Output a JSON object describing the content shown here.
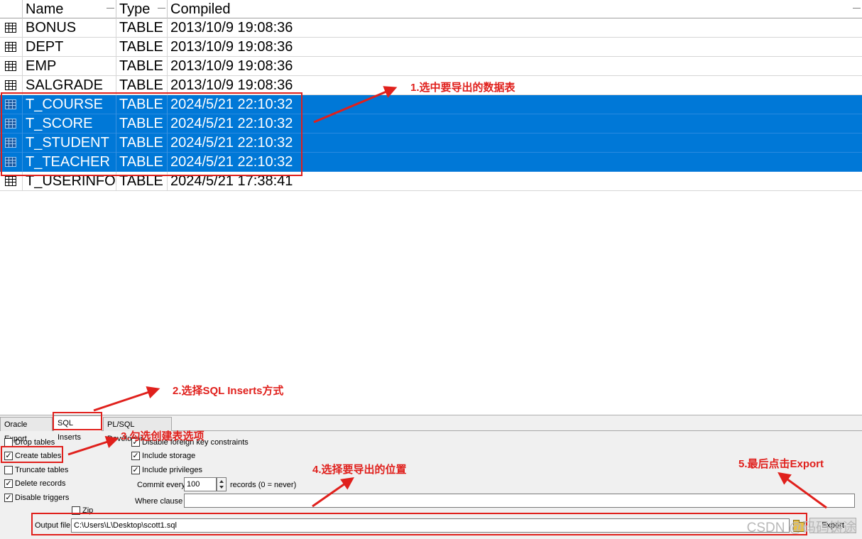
{
  "grid": {
    "columns": {
      "name": "Name",
      "type": "Type",
      "compiled": "Compiled"
    },
    "rows": [
      {
        "name": "BONUS",
        "type": "TABLE",
        "compiled": "2013/10/9 19:08:36",
        "selected": false
      },
      {
        "name": "DEPT",
        "type": "TABLE",
        "compiled": "2013/10/9 19:08:36",
        "selected": false
      },
      {
        "name": "EMP",
        "type": "TABLE",
        "compiled": "2013/10/9 19:08:36",
        "selected": false
      },
      {
        "name": "SALGRADE",
        "type": "TABLE",
        "compiled": "2013/10/9 19:08:36",
        "selected": false
      },
      {
        "name": "T_COURSE",
        "type": "TABLE",
        "compiled": "2024/5/21 22:10:32",
        "selected": true
      },
      {
        "name": "T_SCORE",
        "type": "TABLE",
        "compiled": "2024/5/21 22:10:32",
        "selected": true
      },
      {
        "name": "T_STUDENT",
        "type": "TABLE",
        "compiled": "2024/5/21 22:10:32",
        "selected": true
      },
      {
        "name": "T_TEACHER",
        "type": "TABLE",
        "compiled": "2024/5/21 22:10:32",
        "selected": true
      },
      {
        "name": "T_USERINFO",
        "type": "TABLE",
        "compiled": "2024/5/21 17:38:41",
        "selected": false
      }
    ],
    "row_icon": "table-icon",
    "selection_color": "#0078d7"
  },
  "tabs": [
    {
      "label": "Oracle Export",
      "active": false
    },
    {
      "label": "SQL Inserts",
      "active": true
    },
    {
      "label": "PL/SQL Developer",
      "active": false
    }
  ],
  "options_left": [
    {
      "label": "Drop tables",
      "checked": false
    },
    {
      "label": "Create tables",
      "checked": true
    },
    {
      "label": "Truncate tables",
      "checked": false
    },
    {
      "label": "Delete records",
      "checked": true
    },
    {
      "label": "Disable triggers",
      "checked": true
    }
  ],
  "options_right": [
    {
      "label": "Disable foreign key constraints",
      "checked": true
    },
    {
      "label": "Include storage",
      "checked": true
    },
    {
      "label": "Include privileges",
      "checked": true
    }
  ],
  "commit": {
    "prefix": "Commit every",
    "value": "100",
    "suffix": "records (0 = never)"
  },
  "where": {
    "label": "Where clause",
    "value": ""
  },
  "zip": {
    "label": "Zip",
    "checked": false
  },
  "output": {
    "label": "Output file",
    "value": "C:\\Users\\L\\Desktop\\scott1.sql"
  },
  "export_button": "Export",
  "folder_icon": "folder-open-icon",
  "annotations": {
    "step1": "1.选中要导出的数据表",
    "step2": "2.选择SQL Inserts方式",
    "step3": "3.勾选创建表选项",
    "step4": "4.选择要导出的位置",
    "step5": "5.最后点击Export",
    "color": "#e0201c"
  },
  "watermark": "CSDN @码码铸途"
}
